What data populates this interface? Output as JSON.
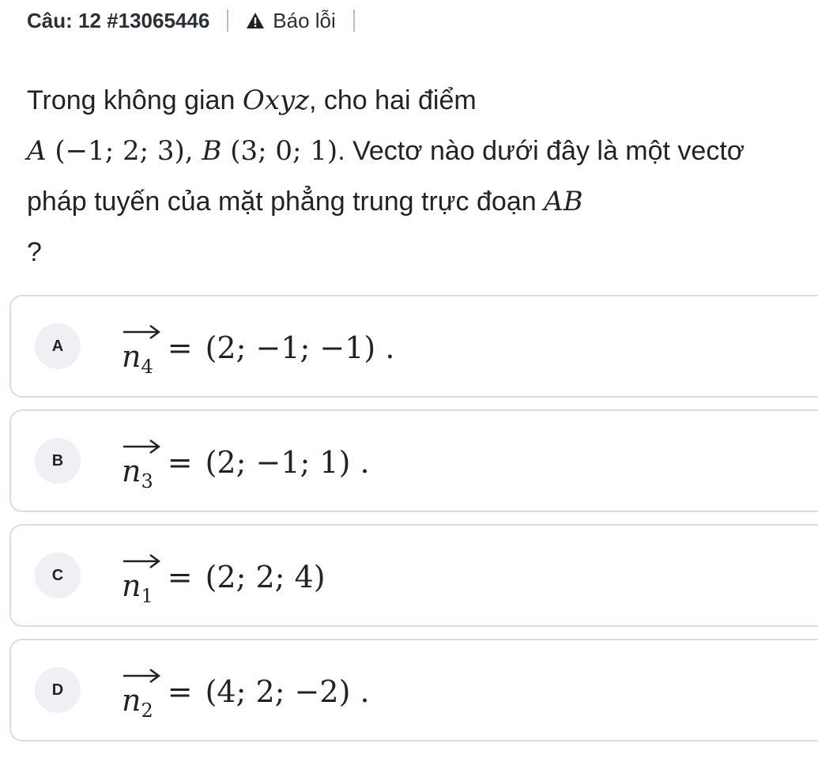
{
  "header": {
    "question_label": "Câu: 12 #13065446",
    "report_label": "Báo lỗi"
  },
  "question": {
    "part1": "Trong không gian ",
    "oxyz": "Oxyz",
    "part2": ", cho hai điểm ",
    "point_a": "A",
    "coord_a": " (−1; 2; 3), ",
    "point_b": "B",
    "coord_b": " (3; 0; 1)",
    "part3": ". Vectơ nào dưới đây là một vectơ pháp tuyến của mặt phẳng trung trực đoạn ",
    "segment": "AB",
    "part4": " ?"
  },
  "options": [
    {
      "letter": "A",
      "vec": "n",
      "sub": "4",
      "eq": "=",
      "value": "(2; −1; −1) ."
    },
    {
      "letter": "B",
      "vec": "n",
      "sub": "3",
      "eq": "=",
      "value": "(2; −1; 1) ."
    },
    {
      "letter": "C",
      "vec": "n",
      "sub": "1",
      "eq": "=",
      "value": "(2; 2; 4)"
    },
    {
      "letter": "D",
      "vec": "n",
      "sub": "2",
      "eq": "=",
      "value": "(4; 2; −2) ."
    }
  ],
  "colors": {
    "border": "#d9dde6",
    "badge_bg": "#eef0f4",
    "warning_icon": "#1f2328"
  },
  "icons": {
    "report": "warning-triangle-icon",
    "vector": "vector-arrow-icon"
  }
}
